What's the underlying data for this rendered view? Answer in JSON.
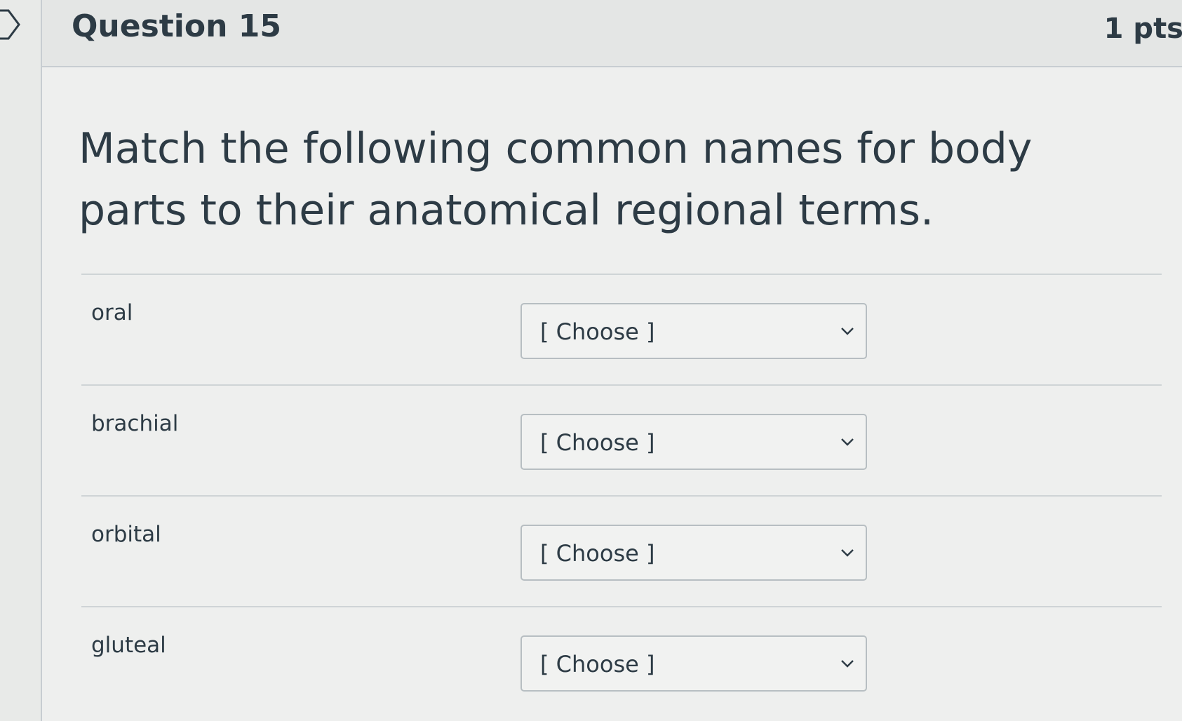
{
  "question": {
    "title": "Question 15",
    "points": "1 pts",
    "prompt": "Match the following common names for body parts to their anatomical regional terms."
  },
  "matches": [
    {
      "term": "oral",
      "selected": "[ Choose ]"
    },
    {
      "term": "brachial",
      "selected": "[ Choose ]"
    },
    {
      "term": "orbital",
      "selected": "[ Choose ]"
    },
    {
      "term": "gluteal",
      "selected": "[ Choose ]"
    }
  ],
  "icons": {
    "rail": "flag-marker-icon",
    "dropdown": "chevron-down-icon"
  },
  "colors": {
    "text": "#2d3b45",
    "border": "#b7bec2",
    "divider": "#cfd4d6"
  }
}
